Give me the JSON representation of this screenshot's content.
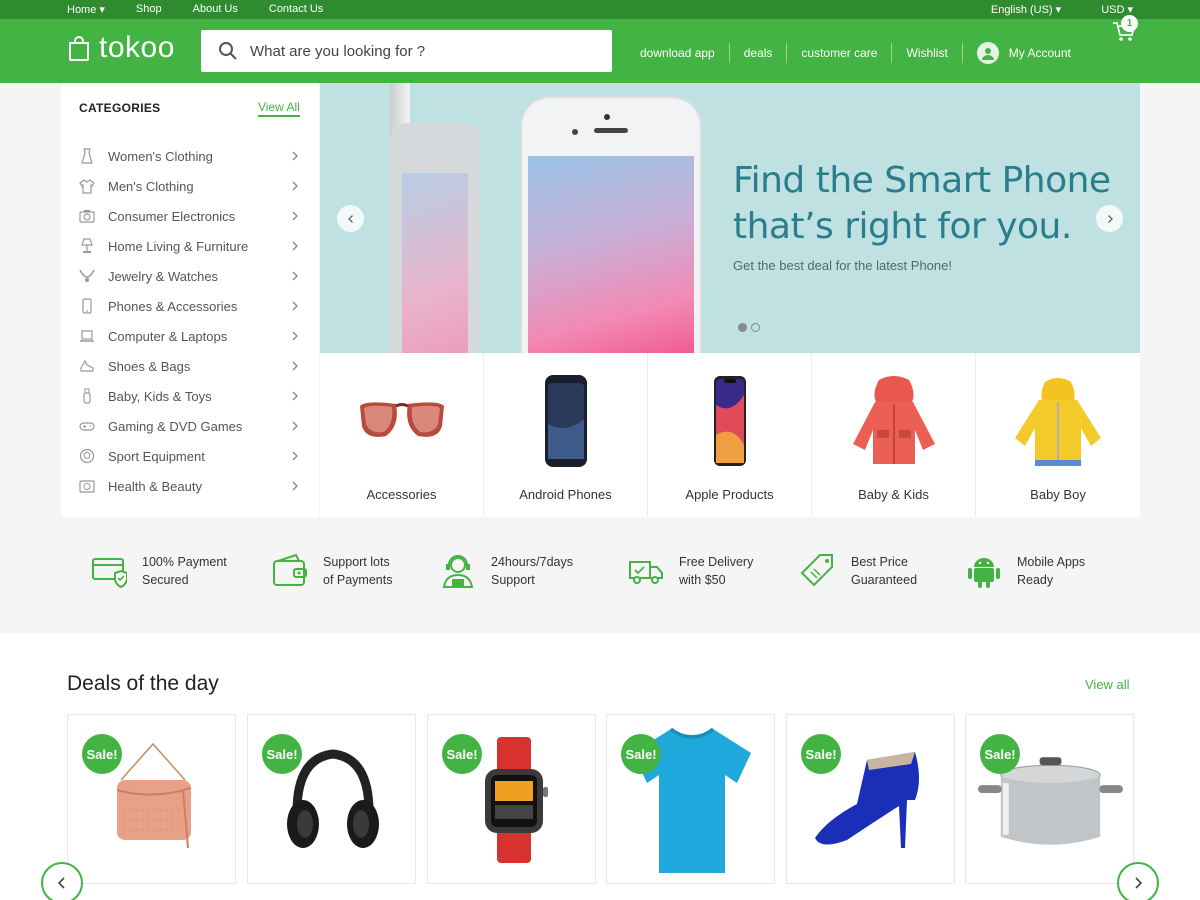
{
  "topbar": {
    "home": "Home ▾",
    "shop": "Shop",
    "about": "About Us",
    "contact": "Contact Us",
    "language": "English (US) ▾",
    "currency": "USD ▾"
  },
  "header": {
    "logo": "tokoo",
    "search_placeholder": "What are you looking for ?",
    "nav": [
      "download app",
      "deals",
      "customer care",
      "Wishlist"
    ],
    "account": "My Account",
    "cart_count": "1",
    "brand_color": "#43b343"
  },
  "categories": {
    "title": "CATEGORIES",
    "view_all": "View All",
    "items": [
      {
        "label": "Women's Clothing",
        "icon": "dress-icon"
      },
      {
        "label": "Men's Clothing",
        "icon": "shirt-icon"
      },
      {
        "label": "Consumer Electronics",
        "icon": "camera-icon"
      },
      {
        "label": "Home Living & Furniture",
        "icon": "lamp-icon"
      },
      {
        "label": "Jewelry & Watches",
        "icon": "necklace-icon"
      },
      {
        "label": "Phones & Accessories",
        "icon": "phone-icon"
      },
      {
        "label": "Computer & Laptops",
        "icon": "laptop-icon"
      },
      {
        "label": "Shoes & Bags",
        "icon": "shoe-icon"
      },
      {
        "label": "Baby, Kids & Toys",
        "icon": "bottle-icon"
      },
      {
        "label": "Gaming & DVD Games",
        "icon": "gamepad-icon"
      },
      {
        "label": "Sport Equipment",
        "icon": "ball-icon"
      },
      {
        "label": "Health & Beauty",
        "icon": "health-icon"
      }
    ]
  },
  "hero": {
    "title_line1": "Find the Smart Phone",
    "title_line2": "that’s right for you.",
    "subtitle": "Get the best deal for the latest Phone!",
    "slides": 2,
    "active_slide": 1
  },
  "featured": [
    {
      "label": "Accessories",
      "image": "sunglasses"
    },
    {
      "label": "Android Phones",
      "image": "android-phone"
    },
    {
      "label": "Apple Products",
      "image": "iphone"
    },
    {
      "label": "Baby & Kids",
      "image": "red-jacket"
    },
    {
      "label": "Baby Boy",
      "image": "yellow-jacket"
    }
  ],
  "features": [
    {
      "line1": "100% Payment",
      "line2": "Secured",
      "icon": "secure-card-icon"
    },
    {
      "line1": "Support lots",
      "line2": "of Payments",
      "icon": "wallet-icon"
    },
    {
      "line1": "24hours/7days",
      "line2": "Support",
      "icon": "support-agent-icon"
    },
    {
      "line1": "Free Delivery",
      "line2": "with $50",
      "icon": "truck-icon"
    },
    {
      "line1": "Best Price",
      "line2": "Guaranteed",
      "icon": "price-tag-icon"
    },
    {
      "line1": "Mobile Apps",
      "line2": "Ready",
      "icon": "android-icon"
    }
  ],
  "deals": {
    "title": "Deals of the day",
    "view_all": "View all",
    "sale_label": "Sale!",
    "products": [
      {
        "image": "handbag"
      },
      {
        "image": "headphones"
      },
      {
        "image": "smartwatch"
      },
      {
        "image": "tshirt"
      },
      {
        "image": "blue-heel"
      },
      {
        "image": "cooking-pot"
      }
    ]
  }
}
